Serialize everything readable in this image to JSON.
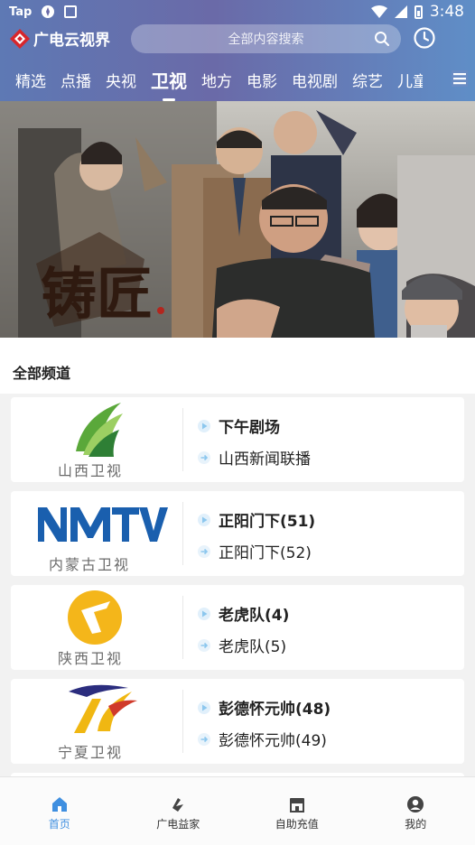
{
  "status_bar": {
    "carrier": "Tap",
    "time": "3:48"
  },
  "header": {
    "app_name": "广电云视界",
    "search_placeholder": "全部内容搜索"
  },
  "tabs": [
    {
      "label": "精选",
      "active": false
    },
    {
      "label": "点播",
      "active": false
    },
    {
      "label": "央视",
      "active": false
    },
    {
      "label": "卫视",
      "active": true
    },
    {
      "label": "地方",
      "active": false
    },
    {
      "label": "电影",
      "active": false
    },
    {
      "label": "电视剧",
      "active": false
    },
    {
      "label": "综艺",
      "active": false
    },
    {
      "label": "儿童",
      "active": false
    }
  ],
  "banner": {
    "poster_title": "铸匠"
  },
  "section": {
    "title": "全部频道"
  },
  "channels": [
    {
      "name": "山西卫视",
      "current": "下午剧场",
      "next": "山西新闻联播"
    },
    {
      "name": "内蒙古卫视",
      "current": "正阳门下(51)",
      "next": "正阳门下(52)"
    },
    {
      "name": "陕西卫视",
      "current": "老虎队(4)",
      "next": "老虎队(5)"
    },
    {
      "name": "宁夏卫视",
      "current": "彭德怀元帅(48)",
      "next": "彭德怀元帅(49)"
    }
  ],
  "bottom_nav": [
    {
      "label": "首页",
      "icon": "home-icon",
      "active": true
    },
    {
      "label": "广电益家",
      "icon": "gd-yijia-icon",
      "active": false
    },
    {
      "label": "自助充值",
      "icon": "store-icon",
      "active": false
    },
    {
      "label": "我的",
      "icon": "user-icon",
      "active": false
    }
  ],
  "colors": {
    "accent": "#3f8fe0",
    "header_gradient_start": "#5e79b4",
    "header_gradient_end": "#5f8ec7",
    "logo_red": "#d7262c"
  }
}
